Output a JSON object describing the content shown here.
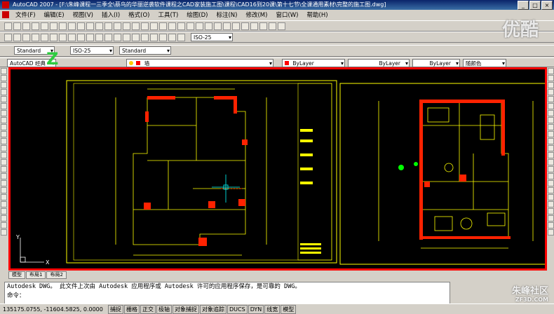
{
  "title_bar": {
    "text": "AutoCAD 2007 - [F:\\朱峰课程一三季全\\蔡鸟的华丽逆袭软件课程之CAD家装施工图\\课程\\CAD16到20课\\第十七节\\全课通用素材\\完整的施工图.dwg]",
    "buttons": [
      "_",
      "□",
      "×"
    ]
  },
  "menu": [
    "文件(F)",
    "编辑(E)",
    "视图(V)",
    "插入(I)",
    "格式(O)",
    "工具(T)",
    "绘图(D)",
    "标注(N)",
    "修改(M)",
    "窗口(W)",
    "帮助(H)"
  ],
  "toolbar_styles": {
    "text_style": "Standard",
    "dim_style": "ISO-25",
    "table_style": "Standard",
    "dim_style_2": "ISO-25"
  },
  "properties_bar": {
    "workspace": "AutoCAD 经典",
    "layer": "墙",
    "color": "ByLayer",
    "linetype": "ByLayer",
    "lineweight": "ByLayer",
    "plotstyle": "随颜色"
  },
  "tabs": [
    "模型",
    "布局1",
    "布局2"
  ],
  "command_line": {
    "line1": "Autodesk DWG。  此文件上次由 Autodesk 应用程序或 Autodesk 许可的应用程序保存，是可靠的 DWG。",
    "line2": "命令："
  },
  "status": {
    "coords": "135175.0755, -11604.5825, 0.0000",
    "buttons": [
      "捕捉",
      "栅格",
      "正交",
      "极轴",
      "对象捕捉",
      "对象追踪",
      "DUCS",
      "DYN",
      "线宽",
      "模型"
    ]
  },
  "watermarks": {
    "top": "优酷",
    "bottom": "朱峰社区",
    "bottom_small": "ZF3D.COM"
  },
  "colors": {
    "canvas": "#000000",
    "highlight_border": "#ff0000",
    "drawing_red": "#ff2200",
    "drawing_yellow": "#ffff00"
  }
}
